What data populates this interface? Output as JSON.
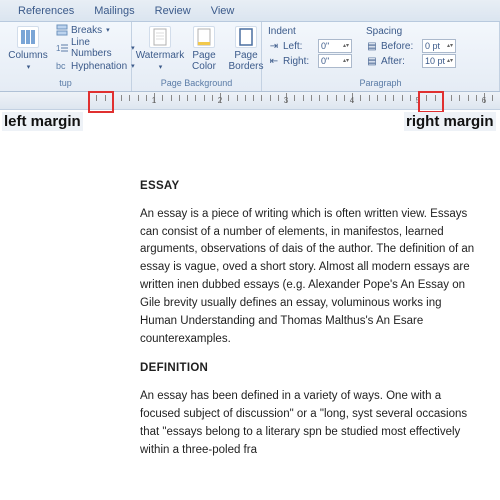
{
  "tabs": {
    "references": "References",
    "mailings": "Mailings",
    "review": "Review",
    "view": "View"
  },
  "setup": {
    "columns": "Columns",
    "breaks": "Breaks",
    "linenumbers": "Line Numbers",
    "hyphenation": "Hyphenation",
    "title": "tup"
  },
  "pagebg": {
    "watermark": "Watermark",
    "pagecolor": "Page\nColor",
    "pageborders": "Page\nBorders",
    "title": "Page Background"
  },
  "paragraph": {
    "indent_hdr": "Indent",
    "spacing_hdr": "Spacing",
    "left_lbl": "Left:",
    "right_lbl": "Right:",
    "before_lbl": "Before:",
    "after_lbl": "After:",
    "left_val": "0\"",
    "right_val": "0\"",
    "before_val": "0 pt",
    "after_val": "10 pt",
    "title": "Paragraph"
  },
  "ruler": {
    "nums": [
      "1",
      "2",
      "3",
      "4",
      "5",
      "6"
    ]
  },
  "annotations": {
    "left": "left margin",
    "right": "right margin"
  },
  "document": {
    "h1": "ESSAY",
    "p1": "An essay is a piece of writing which is often written view. Essays can consist of a number of elements, in manifestos, learned arguments, observations of dais of the author. The definition of an essay is vague, oved a short story. Almost all modern essays are written inen dubbed essays (e.g. Alexander Pope's An Essay on Gile brevity usually defines an essay, voluminous works ing Human Understanding and Thomas Malthus's An Esare counterexamples.",
    "h2": "DEFINITION",
    "p2": "An essay has been defined in a variety of ways. One with a focused subject of discussion\" or a \"long, syst several occasions that \"essays belong to a literary spn be studied most effectively within a three-poled fra"
  }
}
